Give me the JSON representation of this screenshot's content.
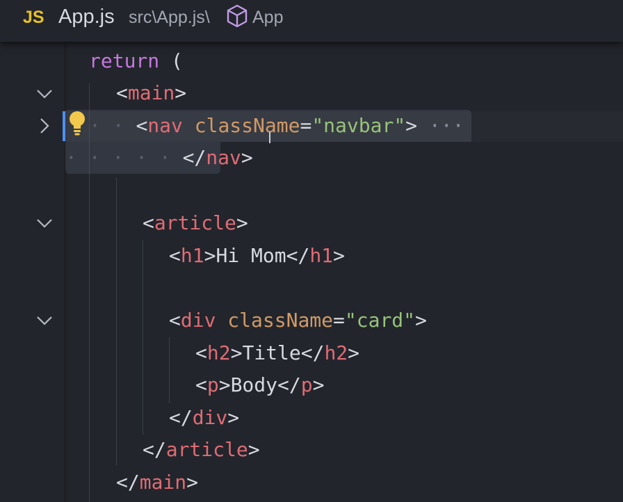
{
  "breadcrumb": {
    "file_type_badge": "JS",
    "file_name": "App.js",
    "file_path": "src\\App.js\\",
    "symbol_icon": "cube-icon",
    "symbol_name": "App"
  },
  "editor": {
    "lightbulb_icon": "lightbulb-icon",
    "code": {
      "return_keyword": "return",
      "open_paren": " (",
      "main_tag": "main",
      "nav_tag": "nav",
      "nav_attr": "className",
      "nav_value": "\"navbar\"",
      "folded_ellipsis": "···",
      "article_tag": "article",
      "h1_tag": "h1",
      "h1_text": "Hi Mom",
      "div_tag": "div",
      "div_attr": "className",
      "div_value": "\"card\"",
      "h2_tag": "h2",
      "h2_text": "Title",
      "p_tag": "p",
      "p_text": "Body"
    }
  },
  "colors": {
    "background": "#22252c",
    "keyword": "#c678dd",
    "tag": "#e06c75",
    "attribute": "#d19a66",
    "string": "#98c379",
    "text": "#d7dae0",
    "js_badge": "#e5c02c",
    "lightbulb": "#f2c94c",
    "cursor_bar": "#4f8ff0"
  }
}
